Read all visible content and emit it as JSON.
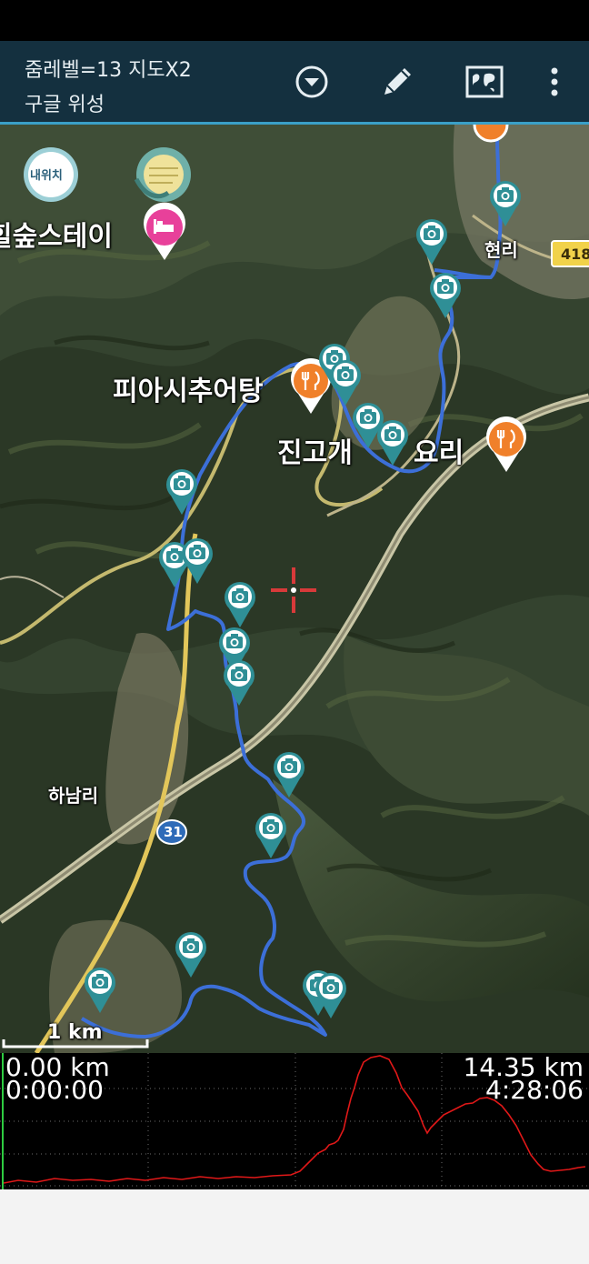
{
  "header": {
    "zoom_label": "줌레벨=13 지도X2",
    "map_type": "구글 위성",
    "icons": [
      "dropdown-circle-icon",
      "pencil-icon",
      "map-icon",
      "more-vert-icon"
    ]
  },
  "map": {
    "my_location_label": "내위치",
    "place_labels": {
      "stay": "힐숲스테이",
      "restaurant1": "피아시추어탕",
      "restaurant2": "진고개",
      "restaurant2_suffix": "요리",
      "village1": "하남리",
      "village2": "현리"
    },
    "road_badges": {
      "route31": "31",
      "route418": "418"
    },
    "scale_label": "1 km",
    "colors": {
      "track": "#3c6fd8",
      "photo_marker": "#2f8f96",
      "restaurant": "#f0802a",
      "lodging": "#e8409a"
    }
  },
  "profile": {
    "left_distance": "0.00 km",
    "left_time": "0:00:00",
    "right_distance": "14.35 km",
    "right_time": "4:28:06",
    "line_color": "#e01818",
    "cursor_color": "#2ecc40"
  }
}
